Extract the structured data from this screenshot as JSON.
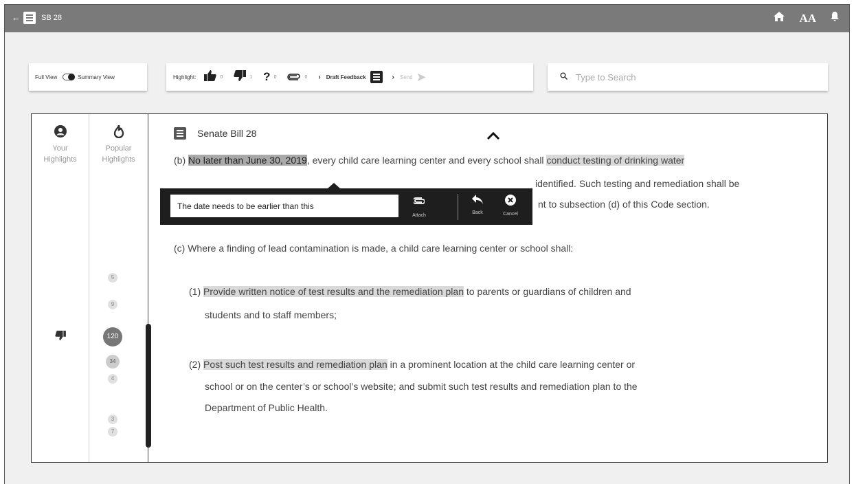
{
  "topbar": {
    "back_icon": "←",
    "title": "SB 28",
    "home_icon": "⌂",
    "font_size_icon": "AA",
    "bell_icon": "🔔"
  },
  "view_toggle": {
    "full_label": "Full View",
    "summary_label": "Summary View"
  },
  "highlight_bar": {
    "label": "Highlight:",
    "items": [
      {
        "icon": "thumbs-up",
        "glyph": "👍",
        "count": "0"
      },
      {
        "icon": "thumbs-down",
        "glyph": "👎",
        "count": "1"
      },
      {
        "icon": "question",
        "glyph": "?",
        "count": "0"
      },
      {
        "icon": "paperclip",
        "glyph": "⊂⊃",
        "count": "0"
      }
    ],
    "draft_label": "Draft Feedback",
    "send_label": "Send"
  },
  "search": {
    "placeholder": "Type to Search"
  },
  "sidebar": {
    "your_highlights": "Your\nHighlights",
    "your_label_1": "Your",
    "your_label_2": "Highlights",
    "popular_label_1": "Popular",
    "popular_label_2": "Highlights",
    "badges": [
      "5",
      "9",
      "120",
      "34",
      "4",
      "3",
      "7"
    ]
  },
  "document": {
    "title": "Senate Bill 28",
    "para_b": {
      "prefix": "(b) ",
      "hl_date": "No later than June 30, 2019",
      "mid": ", every child care learning center and every school shall ",
      "hl_testing": "conduct testing of drinking water",
      "line2_end": "identified. Such testing and remediation shall be",
      "line3_end": "nt to subsection (d) of this Code section."
    },
    "para_c": "(c) Where a finding of lead contamination is made, a child care learning center or school shall:",
    "item1": {
      "num": "(1) ",
      "hl": "Provide written notice of test results and the remediation plan",
      "rest": " to parents or guardians of children and",
      "line2": "students and to staff members;"
    },
    "item2": {
      "num": "(2) ",
      "hl": "Post such test results and remediation plan",
      "rest": " in a prominent location at the child care learning center or",
      "line2": "school or on the center’s or school’s website; and submit such test results and remediation plan to the",
      "line3": "Department of Public Health."
    }
  },
  "comment_popup": {
    "value": "The date needs to be earlier than this",
    "attach_label": "Attach",
    "back_label": "Back",
    "cancel_label": "Cancel"
  }
}
